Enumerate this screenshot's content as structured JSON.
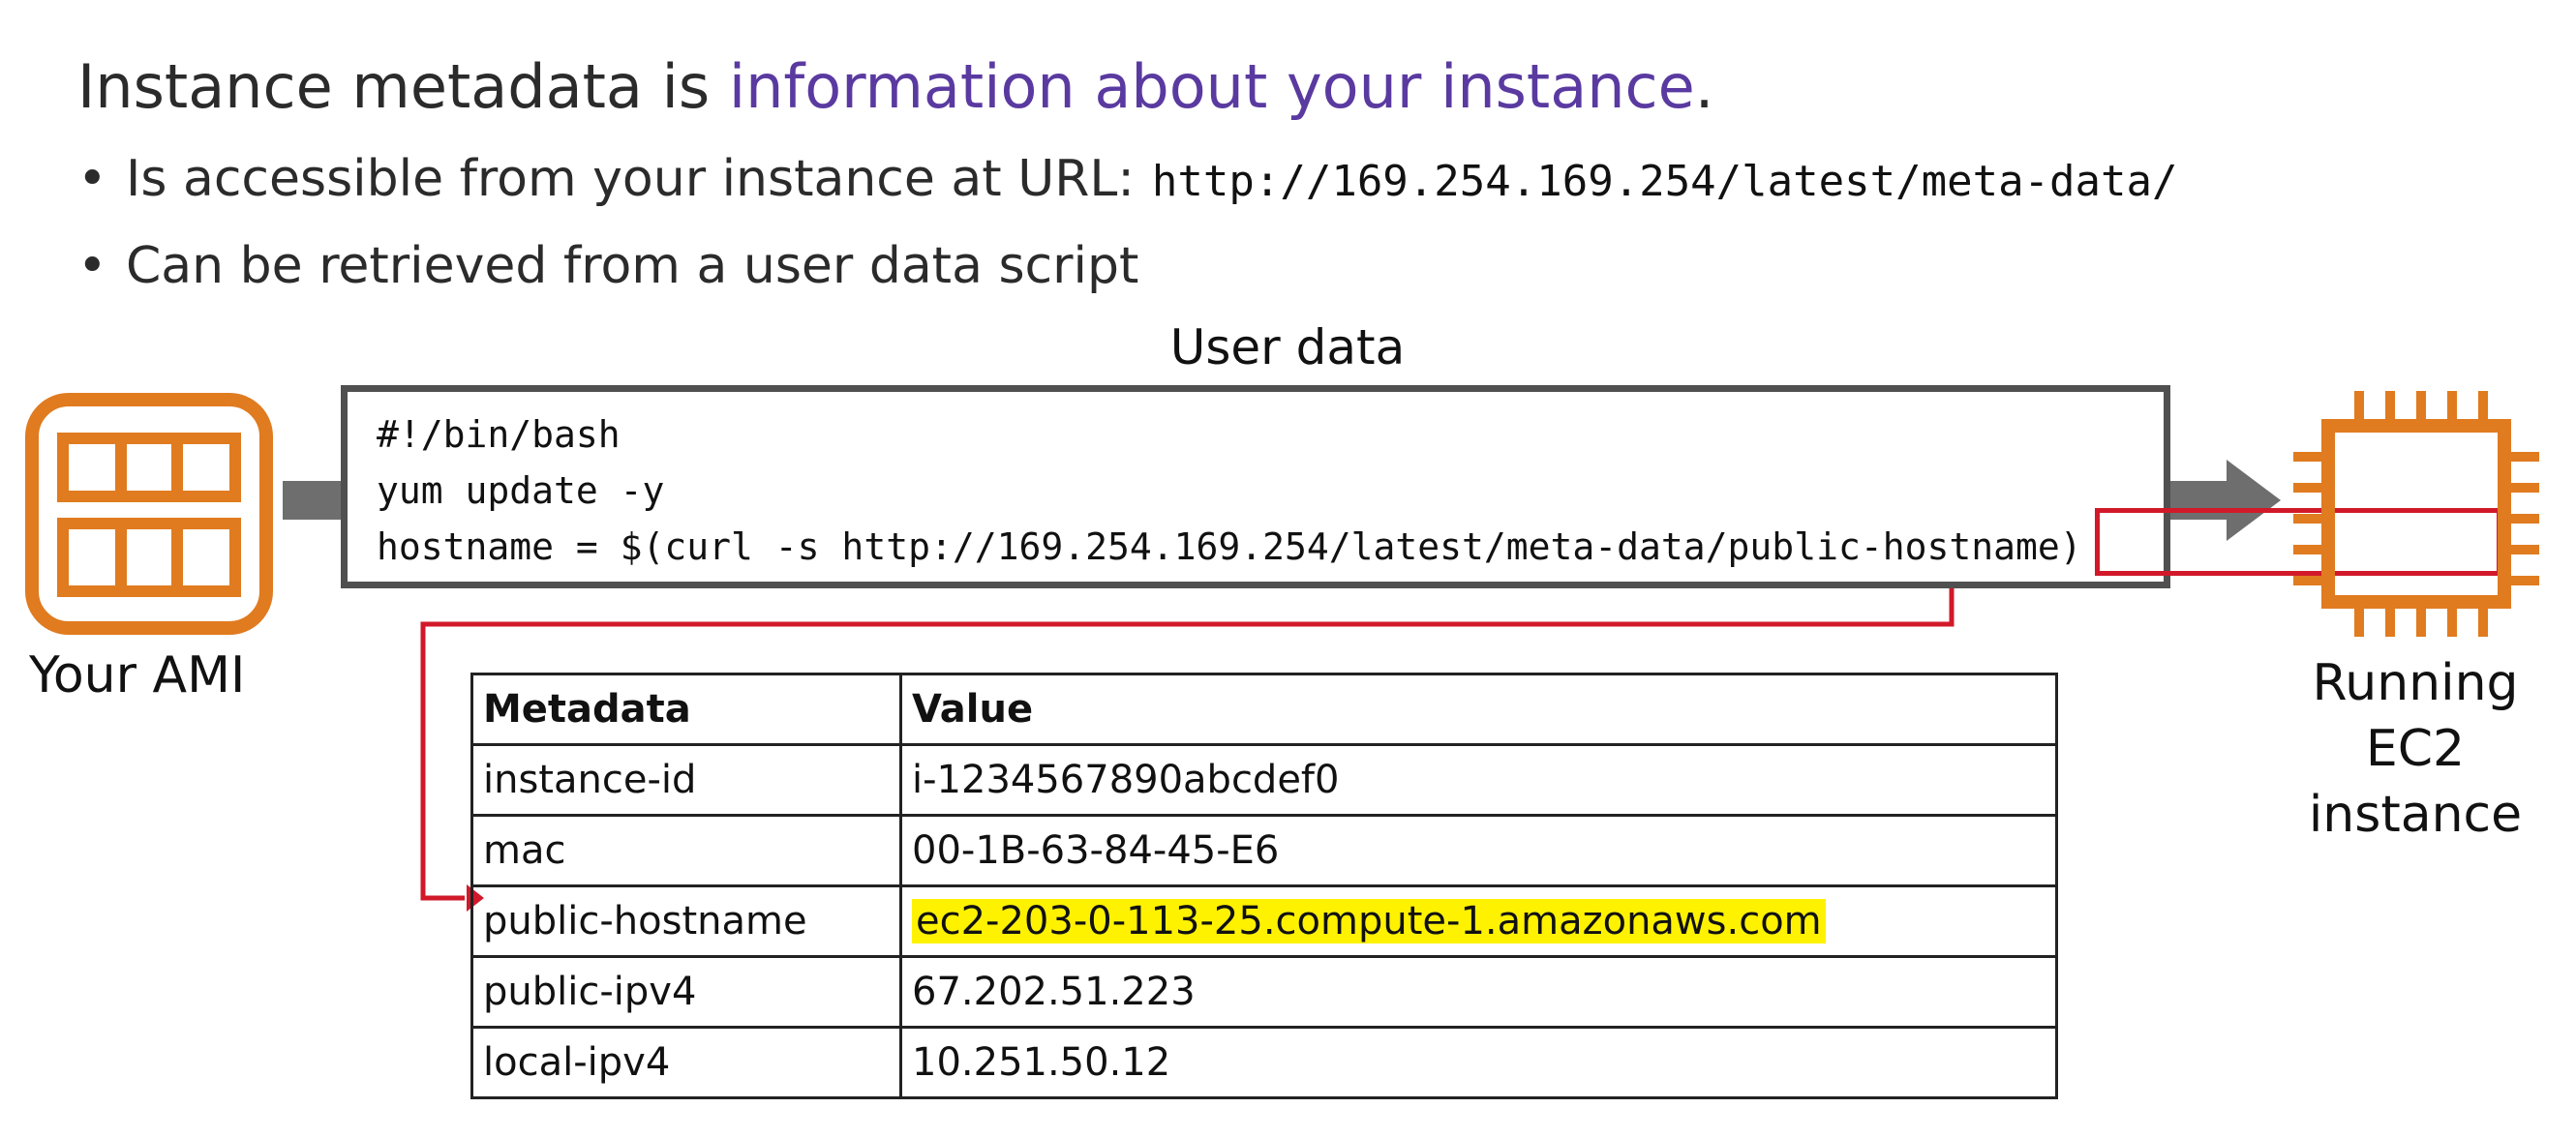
{
  "headline": {
    "prefix": "Instance metadata is ",
    "accent": "information about your instance",
    "suffix": "."
  },
  "bullets": [
    {
      "text": "Is accessible from your instance at URL:",
      "code": "http://169.254.169.254/latest/meta-data/"
    },
    {
      "text": "Can be retrieved from a user data script"
    }
  ],
  "user_data": {
    "title": "User data",
    "lines": [
      "#!/bin/bash",
      "yum update -y",
      "hostname = $(curl -s http://169.254.169.254/latest/meta-data/public-hostname)"
    ]
  },
  "ami": {
    "label": "Your AMI",
    "icon": "ami-icon"
  },
  "ec2": {
    "label_lines": [
      "Running",
      "EC2",
      "instance"
    ],
    "icon": "ec2-chip-icon"
  },
  "table": {
    "headers": [
      "Metadata",
      "Value"
    ],
    "rows": [
      [
        "instance-id",
        "i-1234567890abcdef0"
      ],
      [
        "mac",
        "00-1B-63-84-45-E6"
      ],
      [
        "public-hostname",
        "ec2-203-0-113-25.compute-1.amazonaws.com"
      ],
      [
        "public-ipv4",
        "67.202.51.223"
      ],
      [
        "local-ipv4",
        "10.251.50.12"
      ]
    ]
  },
  "colors": {
    "accent": "#5a3aa0",
    "aws_orange": "#e07b20",
    "highlight_red": "#d1192a",
    "highlight_yellow": "#fff200",
    "arrow_gray": "#6e6e6e"
  }
}
